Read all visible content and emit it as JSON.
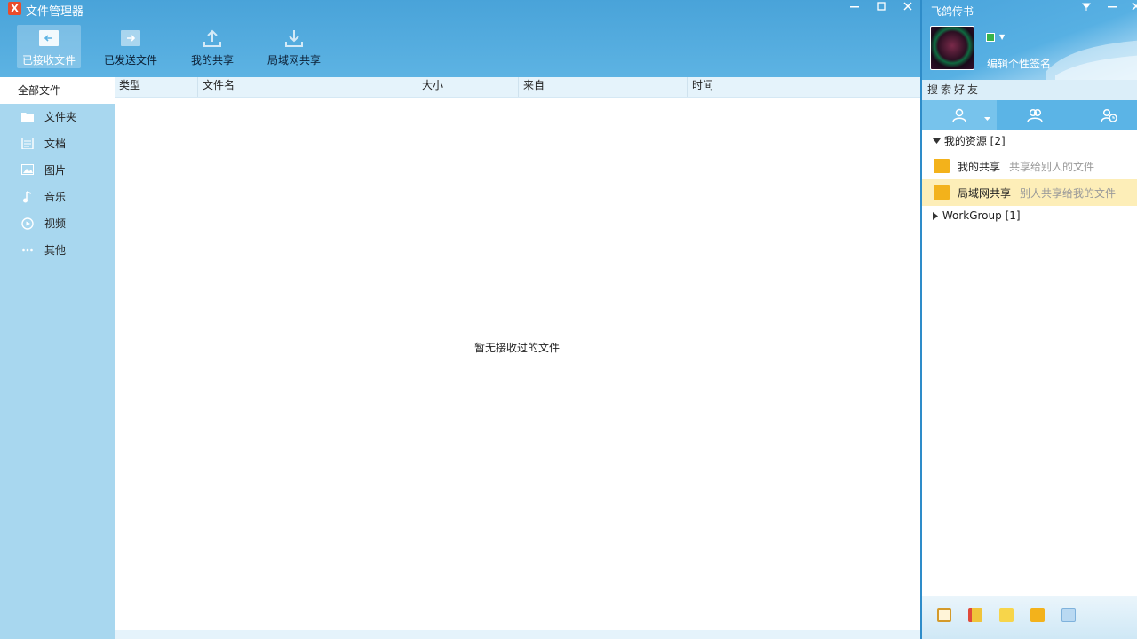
{
  "file_manager": {
    "title": "文件管理器",
    "logo": "X",
    "toolbar": [
      {
        "label": "已接收文件",
        "icon": "received-file-icon",
        "active": true
      },
      {
        "label": "已发送文件",
        "icon": "sent-file-icon",
        "active": false
      },
      {
        "label": "我的共享",
        "icon": "upload-icon",
        "active": false
      },
      {
        "label": "局域网共享",
        "icon": "download-icon",
        "active": false
      }
    ],
    "sidebar": {
      "all_label": "全部文件",
      "items": [
        {
          "label": "文件夹",
          "icon": "folder-icon"
        },
        {
          "label": "文档",
          "icon": "document-icon"
        },
        {
          "label": "图片",
          "icon": "image-icon"
        },
        {
          "label": "音乐",
          "icon": "music-icon"
        },
        {
          "label": "视频",
          "icon": "video-icon"
        },
        {
          "label": "其他",
          "icon": "more-icon"
        }
      ]
    },
    "columns": [
      "类型",
      "文件名",
      "大小",
      "来自",
      "时间"
    ],
    "empty_message": "暂无接收过的文件"
  },
  "feige": {
    "title": "飞鸽传书",
    "signature": "编辑个性签名",
    "search_placeholder": "搜索好友",
    "tree_header": "我的资源 [2]",
    "resources": [
      {
        "name": "我的共享",
        "desc": "共享给别人的文件",
        "selected": false
      },
      {
        "name": "局域网共享",
        "desc": "别人共享给我的文件",
        "selected": true
      }
    ],
    "workgroup": "WorkGroup [1]"
  },
  "colors": {
    "titlebar": "#49a3d9",
    "sidebar": "#a8d7ef",
    "header": "#e5f3fb",
    "selection": "#fdeeb8",
    "folder": "#f3b21b"
  }
}
